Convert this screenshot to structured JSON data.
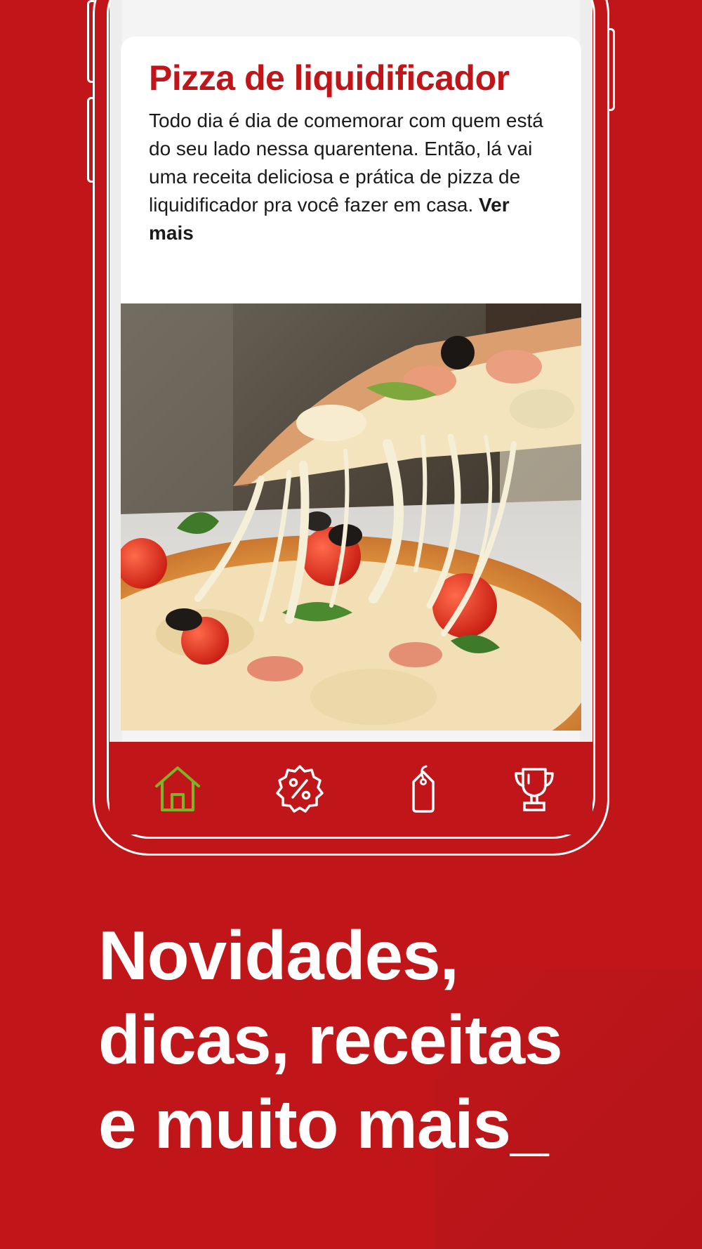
{
  "card": {
    "title": "Pizza de liquidificador",
    "body": "Todo dia é dia de comemorar com quem está do seu lado nessa quarentena. Então, lá vai uma receita deliciosa e prática de pizza de liquidificador pra você fazer em casa.",
    "more_link": "Ver mais",
    "image": "pizza-slice-photo"
  },
  "tabbar": {
    "items": [
      {
        "icon": "home-icon",
        "active": true
      },
      {
        "icon": "discount-badge-icon",
        "active": false
      },
      {
        "icon": "price-tag-icon",
        "active": false
      },
      {
        "icon": "trophy-icon",
        "active": false
      }
    ],
    "active_color": "#7cb327",
    "inactive_color": "#ffffff"
  },
  "headline": {
    "line1": "Novidades,",
    "line2": "dicas, receitas",
    "line3": "e muito mais_"
  },
  "colors": {
    "brand_red": "#c0161a",
    "card_bg": "#ffffff"
  }
}
